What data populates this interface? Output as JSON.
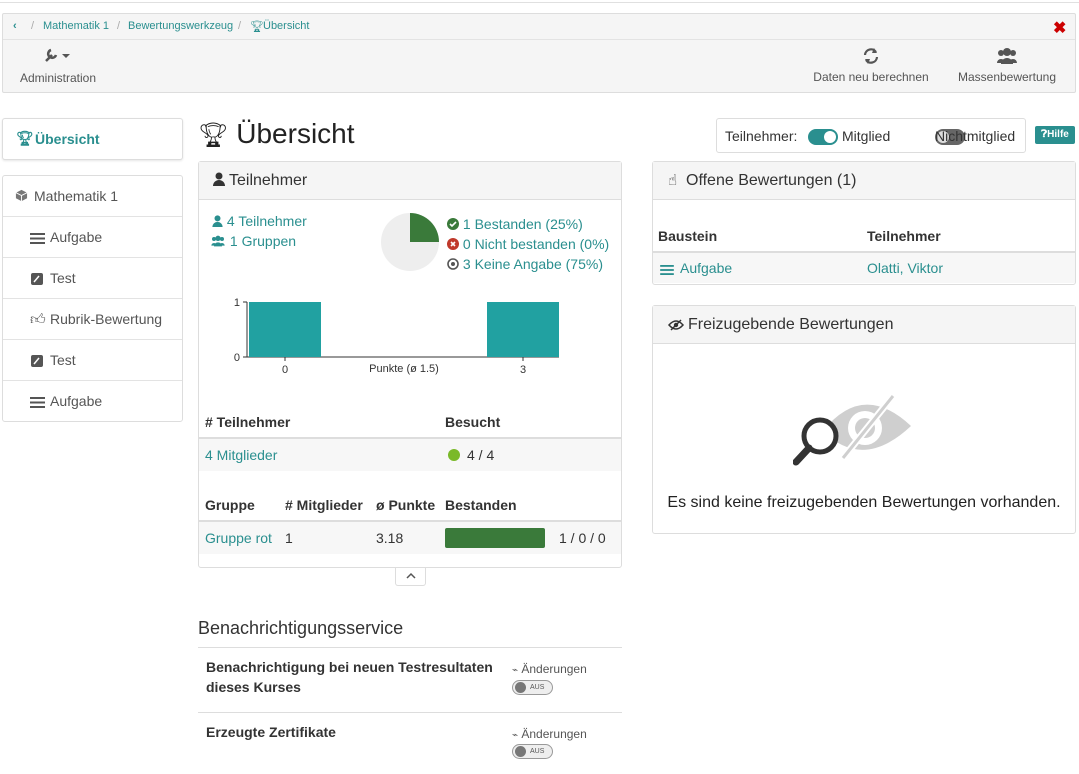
{
  "breadcrumb": {
    "items": [
      "Mathematik 1",
      "Bewertungswerkzeug",
      "Übersicht"
    ],
    "separator": "/"
  },
  "toolbar": {
    "administration": "Administration",
    "recalc": "Daten neu berechnen",
    "bulk": "Massenbewertung"
  },
  "sidebar": {
    "top": "Übersicht",
    "course": "Mathematik 1",
    "items": [
      {
        "label": "Aufgabe",
        "icon": "task-icon"
      },
      {
        "label": "Test",
        "icon": "test-icon"
      },
      {
        "label": "Rubrik-Bewertung",
        "icon": "thumbs-up-icon"
      },
      {
        "label": "Test",
        "icon": "test-icon"
      },
      {
        "label": "Aufgabe",
        "icon": "task-icon"
      }
    ]
  },
  "page": {
    "title": "Übersicht",
    "participants_label": "Teilnehmer:",
    "member_label": "Mitglied",
    "nonmember_label": "Nichtmitglied",
    "member_on": true,
    "nonmember_on": false,
    "help": "Hilfe"
  },
  "participants": {
    "title": "Teilnehmer",
    "count": "4 Teilnehmer",
    "groups": "1 Gruppen",
    "passed": "1 Bestanden (25%)",
    "failed": "0 Nicht bestanden (0%)",
    "none": "3 Keine Angabe (75%)",
    "pie_passed_fraction": 0.25,
    "table_headers": [
      "# Teilnehmer",
      "Besucht"
    ],
    "members": "4 Mitglieder",
    "visited": "4 / 4",
    "group_headers": [
      "Gruppe",
      "# Mitglieder",
      "ø Punkte",
      "Bestanden"
    ],
    "group_row": {
      "name": "Gruppe rot",
      "members": "1",
      "points": "3.18",
      "pass_fraction": 1.0,
      "result": "1 / 0 / 0"
    }
  },
  "chart_data": {
    "type": "bar",
    "categories": [
      "0",
      "3"
    ],
    "values": [
      1,
      1
    ],
    "xlabel": "Punkte (ø 1.5)",
    "ylabel": "",
    "ylim": [
      0,
      1
    ],
    "yticks": [
      "0",
      "1"
    ],
    "xlim": [
      0,
      3
    ],
    "color": "#21a1a1"
  },
  "open_assessments": {
    "title": "Offene Bewertungen (1)",
    "headers": [
      "Baustein",
      "Teilnehmer"
    ],
    "row": {
      "node": "Aufgabe",
      "participant": "Olatti, Viktor"
    }
  },
  "release": {
    "title": "Freizugebende Bewertungen",
    "empty": "Es sind keine freizugebenden Bewertungen vorhanden."
  },
  "notifications": {
    "title": "Benachrichtigungsservice",
    "items": [
      {
        "label": "Benachrichtigung bei neuen Testresultaten dieses Kurses",
        "changes": "Änderungen",
        "state": "AUS"
      },
      {
        "label": "Erzeugte Zertifikate",
        "changes": "Änderungen",
        "state": "AUS"
      }
    ]
  },
  "colors": {
    "accent": "#2a8f8f",
    "green": "#3a7a3a",
    "bar": "#21a1a1",
    "close": "#cc0000"
  }
}
